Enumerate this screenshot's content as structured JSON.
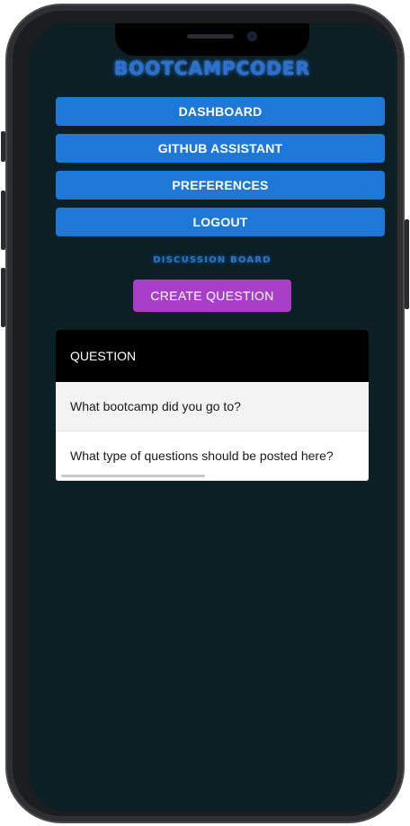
{
  "app": {
    "brand": "BOOTCAMPCODER"
  },
  "nav": {
    "items": [
      {
        "label": "DASHBOARD"
      },
      {
        "label": "GITHUB ASSISTANT"
      },
      {
        "label": "PREFERENCES"
      },
      {
        "label": "LOGOUT"
      }
    ]
  },
  "discussion": {
    "title": "DISCUSSION BOARD",
    "create_label": "CREATE QUESTION"
  },
  "table": {
    "header": "QUESTION",
    "rows": [
      {
        "question": "What bootcamp did you go to?"
      },
      {
        "question": "What type of questions should be posted here?"
      }
    ]
  },
  "colors": {
    "background": "#0b1f25",
    "nav_button": "#1e78d8",
    "create_button": "#a93fc8",
    "brand_glow": "#2e6fcf"
  }
}
